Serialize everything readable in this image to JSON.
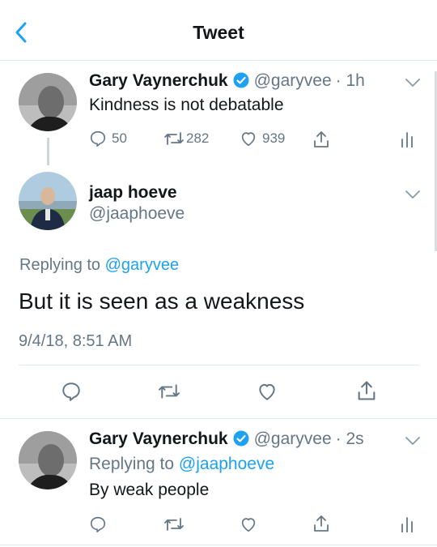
{
  "header": {
    "title": "Tweet",
    "back_icon": "back-chevron-icon"
  },
  "tweet1": {
    "name": "Gary Vaynerchuk",
    "handle": "@garyvee",
    "time": "· 1h",
    "text": "Kindness is not debatable",
    "replies": "50",
    "retweets": "282",
    "likes": "939"
  },
  "tweet2": {
    "name": "jaap hoeve",
    "handle": "@jaaphoeve",
    "replying_prefix": "Replying to ",
    "replying_to": "@garyvee",
    "text": "But it is seen as a weakness",
    "timestamp": "9/4/18, 8:51 AM"
  },
  "tweet3": {
    "name": "Gary Vaynerchuk",
    "handle": "@garyvee",
    "time": "· 2s",
    "replying_prefix": "Replying to ",
    "replying_to": "@jaaphoeve",
    "text": "By weak people"
  },
  "colors": {
    "accent": "#1da1f2",
    "muted": "#657786",
    "text": "#14171a",
    "border": "#e1e8ed"
  }
}
